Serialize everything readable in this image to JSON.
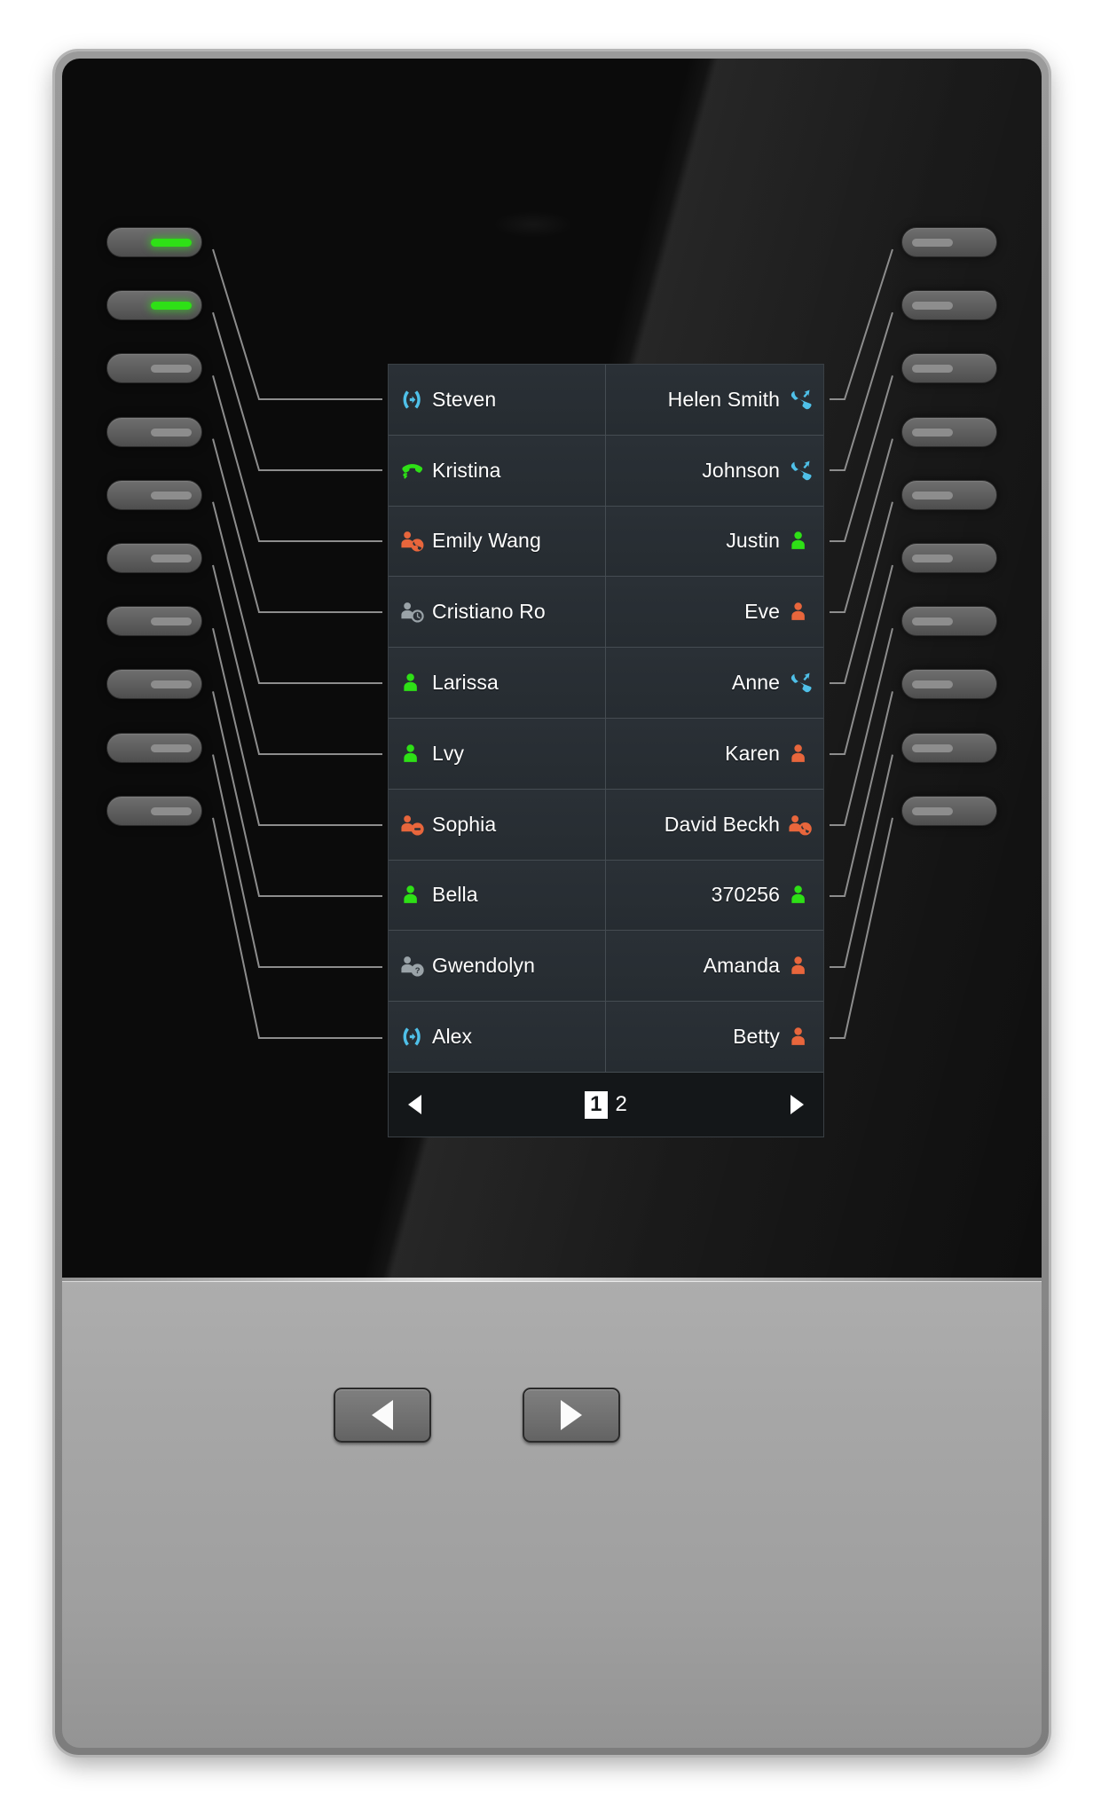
{
  "device": {
    "type": "expansion-module",
    "colors": {
      "lcd_background": "#16191c",
      "row_background": "#2a3036",
      "grid_line": "#454c52",
      "text": "#ffffff",
      "available_green": "#2ee016",
      "busy_orange": "#e8663c",
      "call_blue": "#4fc0e8",
      "offline_gray": "#9aa3a8",
      "led_on": "#2ee016",
      "led_off": "#8d8d8d"
    }
  },
  "lcd": {
    "rows": [
      {
        "left": {
          "label": "Steven",
          "icon": "intercom-icon",
          "icon_color": "#4fc0e8"
        },
        "right": {
          "label": "Helen Smith",
          "icon": "incoming-call-icon",
          "icon_color": "#4fc0e8"
        }
      },
      {
        "left": {
          "label": "Kristina",
          "icon": "handset-active-icon",
          "icon_color": "#2ee016"
        },
        "right": {
          "label": "Johnson",
          "icon": "incoming-call-icon",
          "icon_color": "#4fc0e8"
        }
      },
      {
        "left": {
          "label": "Emily Wang",
          "icon": "user-on-call-icon",
          "icon_color": "#e8663c"
        },
        "right": {
          "label": "Justin",
          "icon": "user-available-icon",
          "icon_color": "#2ee016"
        }
      },
      {
        "left": {
          "label": "Cristiano Ro",
          "icon": "user-away-clock-icon",
          "icon_color": "#9aa3a8"
        },
        "right": {
          "label": "Eve",
          "icon": "user-busy-icon",
          "icon_color": "#e8663c"
        }
      },
      {
        "left": {
          "label": "Larissa",
          "icon": "user-available-icon",
          "icon_color": "#2ee016"
        },
        "right": {
          "label": "Anne",
          "icon": "incoming-call-icon",
          "icon_color": "#4fc0e8"
        }
      },
      {
        "left": {
          "label": "Lvy",
          "icon": "user-available-icon",
          "icon_color": "#2ee016"
        },
        "right": {
          "label": "Karen",
          "icon": "user-busy-icon",
          "icon_color": "#e8663c"
        }
      },
      {
        "left": {
          "label": "Sophia",
          "icon": "user-dnd-icon",
          "icon_color": "#e8663c"
        },
        "right": {
          "label": "David Beckh",
          "icon": "user-ringing-icon",
          "icon_color": "#e8663c"
        }
      },
      {
        "left": {
          "label": "Bella",
          "icon": "user-available-icon",
          "icon_color": "#2ee016"
        },
        "right": {
          "label": "370256",
          "icon": "user-available-icon",
          "icon_color": "#2ee016"
        }
      },
      {
        "left": {
          "label": "Gwendolyn",
          "icon": "user-unknown-icon",
          "icon_color": "#9aa3a8"
        },
        "right": {
          "label": "Amanda",
          "icon": "user-busy-icon",
          "icon_color": "#e8663c"
        }
      },
      {
        "left": {
          "label": "Alex",
          "icon": "intercom-icon",
          "icon_color": "#4fc0e8"
        },
        "right": {
          "label": "Betty",
          "icon": "user-busy-icon",
          "icon_color": "#e8663c"
        }
      }
    ],
    "pager": {
      "prev_icon": "triangle-left-icon",
      "next_icon": "triangle-right-icon",
      "pages": [
        {
          "label": "1",
          "active": true
        },
        {
          "label": "2",
          "active": false
        }
      ]
    }
  },
  "left_keys": [
    {
      "index": 1,
      "led": "on"
    },
    {
      "index": 2,
      "led": "on"
    },
    {
      "index": 3,
      "led": "off"
    },
    {
      "index": 4,
      "led": "off"
    },
    {
      "index": 5,
      "led": "off"
    },
    {
      "index": 6,
      "led": "off"
    },
    {
      "index": 7,
      "led": "off"
    },
    {
      "index": 8,
      "led": "off"
    },
    {
      "index": 9,
      "led": "off"
    },
    {
      "index": 10,
      "led": "off"
    }
  ],
  "right_keys": [
    {
      "index": 1,
      "led": "off"
    },
    {
      "index": 2,
      "led": "off"
    },
    {
      "index": 3,
      "led": "off"
    },
    {
      "index": 4,
      "led": "off"
    },
    {
      "index": 5,
      "led": "off"
    },
    {
      "index": 6,
      "led": "off"
    },
    {
      "index": 7,
      "led": "off"
    },
    {
      "index": 8,
      "led": "off"
    },
    {
      "index": 9,
      "led": "off"
    },
    {
      "index": 10,
      "led": "off"
    }
  ],
  "bottom_keys": [
    {
      "name": "page-prev",
      "icon": "triangle-left-icon"
    },
    {
      "name": "page-next",
      "icon": "triangle-right-icon"
    }
  ]
}
